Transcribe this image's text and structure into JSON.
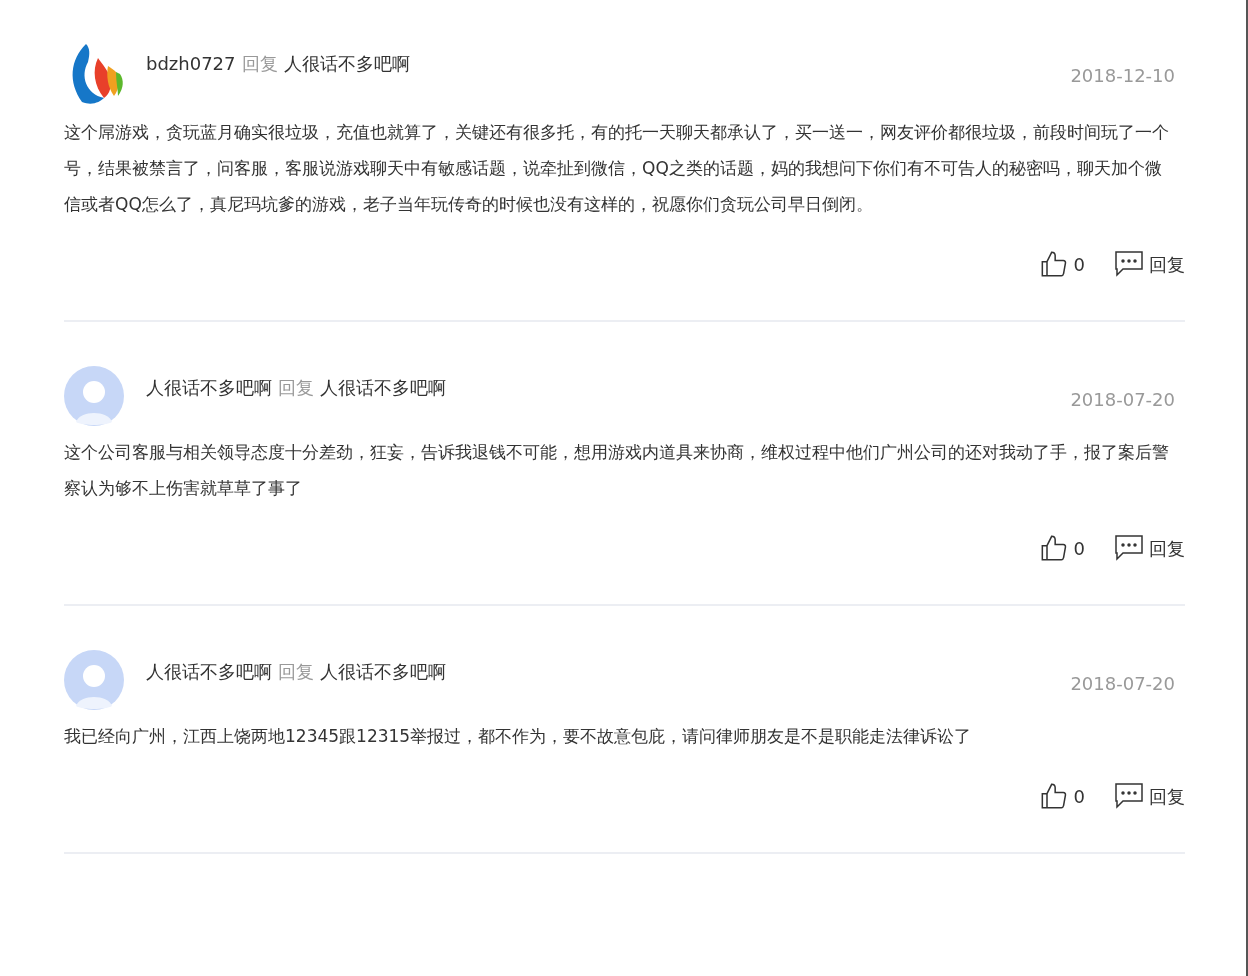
{
  "comments": [
    {
      "avatar": {
        "kind": "logo"
      },
      "author": "bdzh0727",
      "reply_word": "回复",
      "reply_to": "人很话不多吧啊",
      "date": "2018-12-10",
      "text": "这个屌游戏，贪玩蓝月确实很垃圾，充值也就算了，关键还有很多托，有的托一天聊天都承认了，买一送一，网友评价都很垃圾，前段时间玩了一个号，结果被禁言了，问客服，客服说游戏聊天中有敏感话题，说牵扯到微信，QQ之类的话题，妈的我想问下你们有不可告人的秘密吗，聊天加个微信或者QQ怎么了，真尼玛坑爹的游戏，老子当年玩传奇的时候也没有这样的，祝愿你们贪玩公司早日倒闭。",
      "likes": "0",
      "reply_button": "回复"
    },
    {
      "avatar": {
        "kind": "default"
      },
      "author": "人很话不多吧啊",
      "reply_word": "回复",
      "reply_to": "人很话不多吧啊",
      "date": "2018-07-20",
      "text": "这个公司客服与相关领导态度十分差劲，狂妄，告诉我退钱不可能，想用游戏内道具来协商，维权过程中他们广州公司的还对我动了手，报了案后警察认为够不上伤害就草草了事了",
      "likes": "0",
      "reply_button": "回复"
    },
    {
      "avatar": {
        "kind": "default"
      },
      "author": "人很话不多吧啊",
      "reply_word": "回复",
      "reply_to": "人很话不多吧啊",
      "date": "2018-07-20",
      "text": "我已经向广州，江西上饶两地12345跟12315举报过，都不作为，要不故意包庇，请问律师朋友是不是职能走法律诉讼了",
      "likes": "0",
      "reply_button": "回复"
    }
  ]
}
